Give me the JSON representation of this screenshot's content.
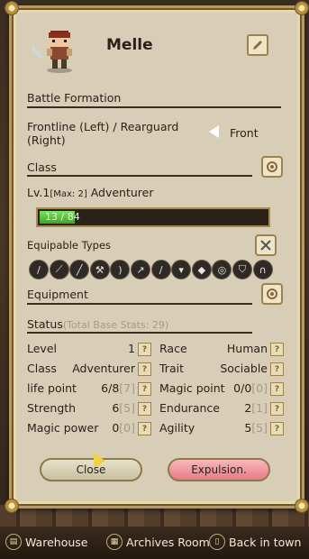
{
  "character": {
    "name": "Melle"
  },
  "battle_formation": {
    "title": "Battle Formation",
    "label": "Frontline (Left) / Rearguard (Right)",
    "value": "Front"
  },
  "class": {
    "title": "Class",
    "level_prefix": "Lv.1",
    "level_max": "[Max: 2]",
    "class_name": "Adventurer",
    "exp_text": "13 / 84",
    "exp_fraction": 0.155
  },
  "equipable": {
    "title": "Equipable Types",
    "types": [
      "sword-icon",
      "dagger-icon",
      "greatsword-icon",
      "axe-icon",
      "bow-icon",
      "spear-icon",
      "staff-icon",
      "light-armor-icon",
      "heavy-armor-icon",
      "shield-round-icon",
      "shield-icon",
      "helmet-icon"
    ]
  },
  "equipment": {
    "title": "Equipment"
  },
  "status": {
    "title": "Status",
    "subtitle": "(Total Base Stats: 29)",
    "left": [
      {
        "label": "Level",
        "value": "1",
        "extra": ""
      },
      {
        "label": "Class",
        "value": "Adventurer",
        "extra": ""
      },
      {
        "label": "life point",
        "value": "6/8",
        "extra": "[7]"
      },
      {
        "label": "Strength",
        "value": "6",
        "extra": "[5]"
      },
      {
        "label": "Magic power",
        "value": "0",
        "extra": "[0]"
      }
    ],
    "right": [
      {
        "label": "Race",
        "value": "Human",
        "extra": ""
      },
      {
        "label": "Trait",
        "value": "Sociable",
        "extra": ""
      },
      {
        "label": "Magic point",
        "value": "0/0",
        "extra": "[0]"
      },
      {
        "label": "Endurance",
        "value": "2",
        "extra": "[1]"
      },
      {
        "label": "Agility",
        "value": "5",
        "extra": "[5]"
      }
    ]
  },
  "buttons": {
    "close": "Close",
    "expel": "Expulsion."
  },
  "bottom_nav": {
    "warehouse": "Warehouse",
    "archives": "Archives Room",
    "back": "Back in town"
  },
  "colors": {
    "panel": "#d8cdb6",
    "exp_fill": "#5ccf3c",
    "expel_button": "#ef9aa3"
  }
}
